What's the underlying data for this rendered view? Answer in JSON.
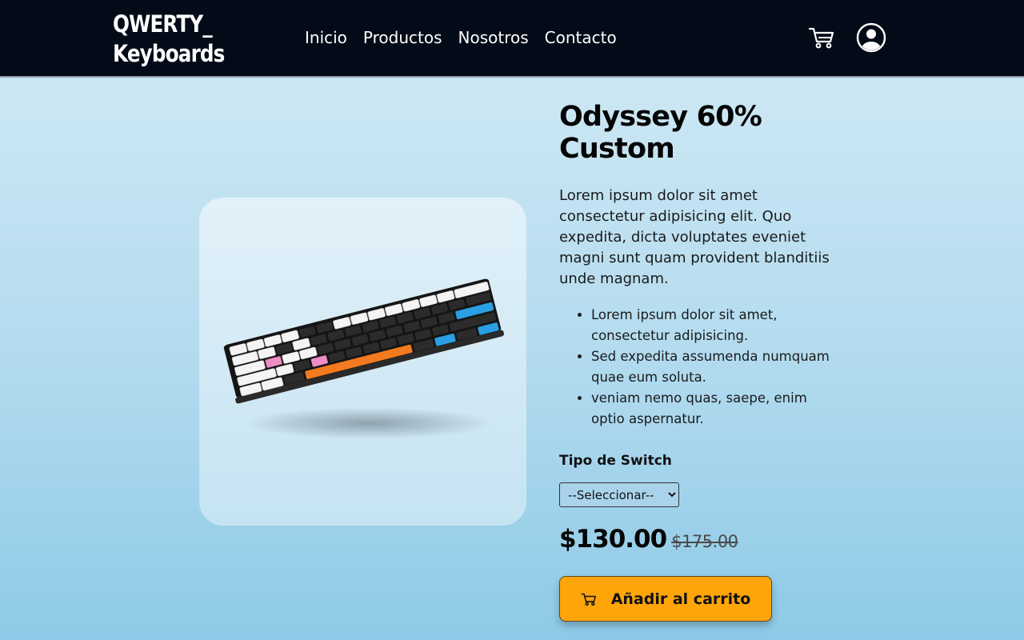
{
  "header": {
    "logo_line1": "QWERTY_",
    "logo_line2": "Keyboards",
    "nav": [
      "Inicio",
      "Productos",
      "Nosotros",
      "Contacto"
    ],
    "icons": [
      "cart-icon",
      "user-icon"
    ]
  },
  "product": {
    "image_alt": "Odyssey 60% Custom keyboard",
    "title": "Odyssey 60% Custom",
    "description": "Lorem ipsum dolor sit amet consectetur adipisicing elit. Quo expedita, dicta voluptates eveniet magni sunt quam provident blanditiis unde magnam.",
    "features": [
      "Lorem ipsum dolor sit amet, consectetur adipisicing.",
      "Sed expedita assumenda numquam quae eum soluta.",
      "veniam nemo quas, saepe, enim optio aspernatur."
    ],
    "switch_label": "Tipo de Switch",
    "switch_selected": "--Seleccionar--",
    "price": "$130.00",
    "old_price": "$175.00",
    "add_to_cart": "Añadir al carrito"
  },
  "colors": {
    "header_bg": "#020b17",
    "accent_button": "#ffa50a",
    "keyboard_accent_orange": "#f47a1f",
    "keyboard_accent_blue": "#2a9fe3",
    "keyboard_accent_pink": "#f08cc4"
  }
}
